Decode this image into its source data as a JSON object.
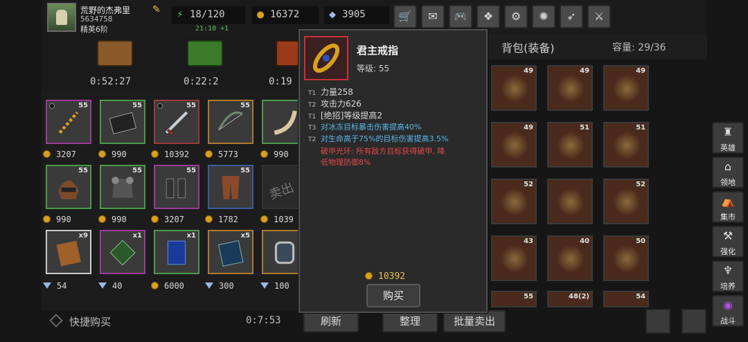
{
  "player": {
    "name": "荒野的杰弗里",
    "id": "5634758",
    "rank": "精英6阶",
    "stamina": "18/120",
    "stamina_timer": "21:10 +1",
    "gold": "16372",
    "gems": "3905"
  },
  "toolbar": {
    "icons": [
      "shop-cart-icon",
      "mail-icon",
      "gamepad-icon",
      "compass-icon",
      "gear-icon",
      "pinwheel-icon",
      "feather-icon",
      "crossed-swords-icon"
    ]
  },
  "chests": [
    {
      "timer": "0:52:27",
      "color": "#8a5a2a"
    },
    {
      "timer": "0:22:2",
      "color": "#3a7a2a"
    },
    {
      "timer": "0:19",
      "color": "#9a3a1a"
    }
  ],
  "shop": {
    "rows": [
      [
        {
          "badge": "55",
          "icon": "golden-chain-icon",
          "border": "#9a3a9a",
          "cost_type": "gold",
          "price": "3207"
        },
        {
          "badge": "55",
          "icon": "book-icon",
          "border": "#4a9a4a",
          "cost_type": "gold",
          "price": "990"
        },
        {
          "badge": "55",
          "icon": "dagger-icon",
          "border": "#9a3a3a",
          "cost_type": "gold",
          "price": "10392"
        },
        {
          "badge": "55",
          "icon": "bow-icon",
          "border": "#b07a2a",
          "cost_type": "gold",
          "price": "5773"
        },
        {
          "badge": "",
          "icon": "horn-icon",
          "border": "#4a9a4a",
          "cost_type": "gold",
          "price": "990"
        }
      ],
      [
        {
          "badge": "55",
          "icon": "helmet-icon",
          "border": "#4a9a4a",
          "cost_type": "gold",
          "price": "990"
        },
        {
          "badge": "55",
          "icon": "armor-icon",
          "border": "#4a9a4a",
          "cost_type": "gold",
          "price": "990"
        },
        {
          "badge": "55",
          "icon": "gloves-icon",
          "border": "#9a3a9a",
          "cost_type": "gold",
          "price": "3207"
        },
        {
          "badge": "55",
          "icon": "leg-armor-icon",
          "border": "#3a5a9a",
          "cost_type": "gold",
          "price": "1782"
        },
        {
          "badge": "",
          "icon": "sold-out-icon",
          "border": "#333333",
          "cost_type": "gold",
          "price": "1039"
        }
      ],
      [
        {
          "badge": "x9",
          "icon": "skill-book-icon",
          "border": "#cccccc",
          "cost_type": "gem",
          "price": "54"
        },
        {
          "badge": "x1",
          "icon": "green-scroll-icon",
          "border": "#9a3a9a",
          "cost_type": "gem",
          "price": "40"
        },
        {
          "badge": "x1",
          "icon": "blue-card-icon",
          "border": "#4a9a4a",
          "cost_type": "gold",
          "price": "6000"
        },
        {
          "badge": "x5",
          "icon": "blue-book-icon",
          "border": "#b07a2a",
          "cost_type": "gem",
          "price": "300"
        },
        {
          "badge": "",
          "icon": "mirror-icon",
          "border": "#b07a2a",
          "cost_type": "gem",
          "price": "100"
        }
      ]
    ],
    "sold_out_label": "卖出"
  },
  "bottom": {
    "quick_buy": "快捷购买",
    "refresh_timer": "0:7:53",
    "refresh": "刷新",
    "sort": "整理",
    "bulk_sell": "批量卖出"
  },
  "bag": {
    "title": "背包(装备)",
    "capacity_label": "容量: 29/36",
    "items": [
      {
        "badge": "49",
        "icon": "curved-blade-icon"
      },
      {
        "badge": "49",
        "icon": "gauntlets-icon"
      },
      {
        "badge": "49",
        "icon": "boots-icon"
      },
      {
        "badge": "49",
        "icon": "sword-icon"
      },
      {
        "badge": "51",
        "icon": "chest-armor-icon"
      },
      {
        "badge": "51",
        "icon": "amulet-icon"
      },
      {
        "badge": "52",
        "icon": "gauntlets-icon"
      },
      {
        "badge": "",
        "icon": "gauntlets-icon"
      },
      {
        "badge": "52",
        "icon": "helmet-icon"
      },
      {
        "badge": "43",
        "icon": "chest-armor-icon"
      },
      {
        "badge": "40",
        "icon": "chest-armor-icon"
      },
      {
        "badge": "50",
        "icon": "staff-icon"
      },
      {
        "badge": "55",
        "icon": "helmet-icon"
      },
      {
        "badge": "48(2)",
        "icon": "gauntlets-icon"
      },
      {
        "badge": "54",
        "icon": "axe-icon"
      }
    ]
  },
  "sidenav": [
    {
      "label": "英雄",
      "icon": "hero-helmet-icon"
    },
    {
      "label": "领地",
      "icon": "territory-icon"
    },
    {
      "label": "集市",
      "icon": "market-icon"
    },
    {
      "label": "强化",
      "icon": "enhance-icon"
    },
    {
      "label": "培养",
      "icon": "train-icon"
    },
    {
      "label": "战斗",
      "icon": "portal-icon"
    }
  ],
  "tooltip": {
    "item_name": "君主戒指",
    "level": "等级: 55",
    "stats": [
      {
        "tier": "T1",
        "text": "力量258",
        "color": "#d8d8d8"
      },
      {
        "tier": "T2",
        "text": "攻击力626",
        "color": "#d8d8d8"
      },
      {
        "tier": "T1",
        "text": "[绝招]等级提高2",
        "color": "#d8d8d8"
      },
      {
        "tier": "T3",
        "text": "对冰冻目标暴击伤害提高40%",
        "color": "#5ab4e8"
      },
      {
        "tier": "T2",
        "text": "对生命高于75%的目标伤害提高3.5%",
        "color": "#5ab4e8"
      }
    ],
    "special_line1": "破甲光环: 所有敌方目标获得破甲, 降",
    "special_line2": "低物理防御8%",
    "price": "10392",
    "buy_label": "购买"
  }
}
